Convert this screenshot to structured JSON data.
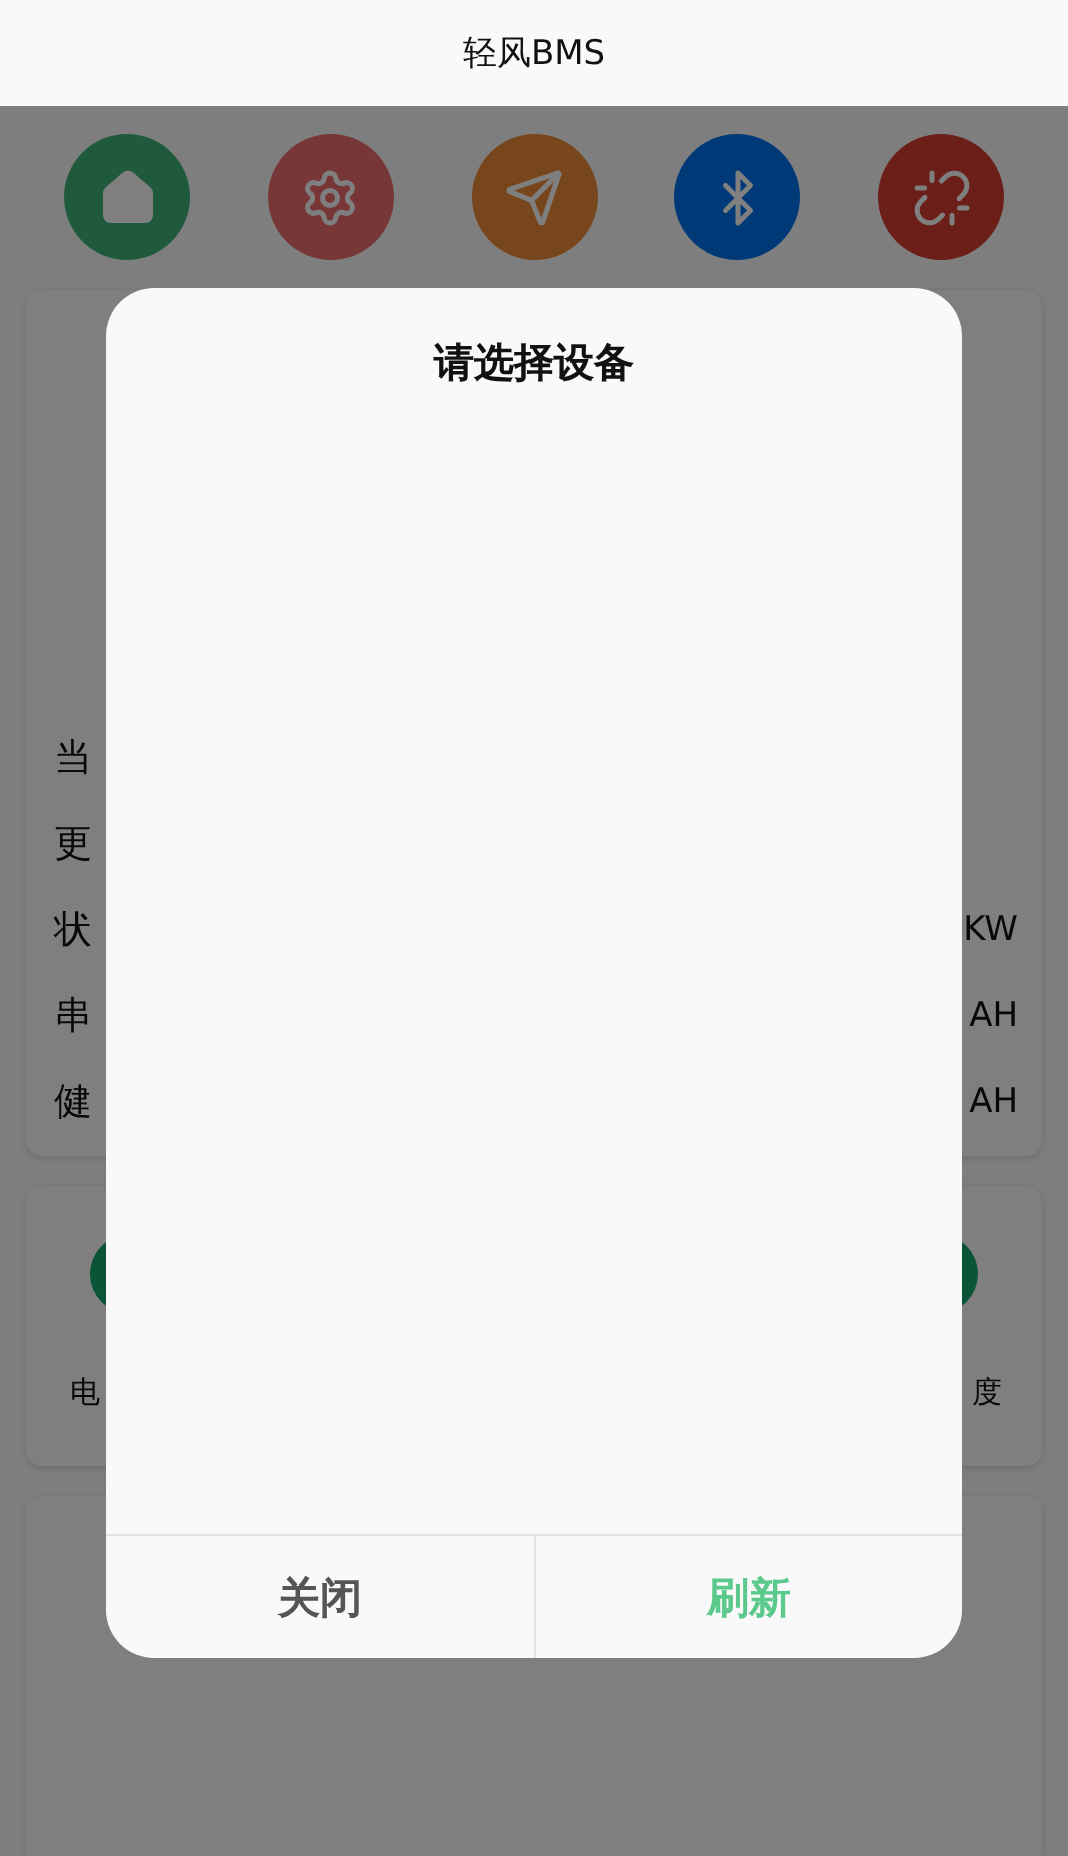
{
  "header": {
    "title": "轻风BMS"
  },
  "toolbar": [
    {
      "kind": "home"
    },
    {
      "kind": "settings"
    },
    {
      "kind": "send"
    },
    {
      "kind": "bluetooth"
    },
    {
      "kind": "disconnect"
    }
  ],
  "status_card": {
    "rows": [
      {
        "label": "当"
      },
      {
        "label": "更"
      },
      {
        "label": "状",
        "unit": "KW"
      },
      {
        "label": "串",
        "unit": "AH"
      },
      {
        "label": "健",
        "unit": "AH"
      }
    ]
  },
  "metrics_card": {
    "labels": [
      "电",
      "度"
    ]
  },
  "dialog": {
    "title": "请选择设备",
    "buttons": [
      {
        "kind": "close",
        "label": "关闭"
      },
      {
        "kind": "refresh",
        "label": "刷新"
      }
    ]
  }
}
